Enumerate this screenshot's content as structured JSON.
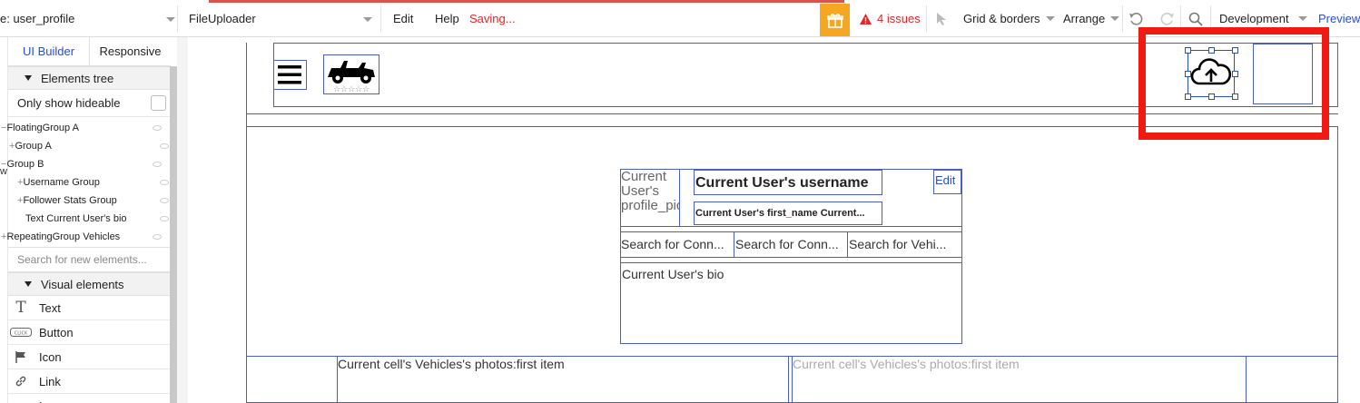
{
  "toolbar": {
    "page_name": "e: user_profile",
    "element_name": "FileUploader",
    "edit": "Edit",
    "help": "Help",
    "status": "Saving...",
    "issues": "4 issues",
    "grid": "Grid & borders",
    "arrange": "Arrange",
    "environment": "Development",
    "preview": "Preview",
    "colors": {
      "status_red": "#e0262b",
      "accent_blue": "#2a4ec4",
      "gift_orange": "#f5a623"
    }
  },
  "left_panel": {
    "tabs": [
      "UI Builder",
      "Responsive"
    ],
    "elements_tree_header": "Elements tree",
    "only_show_hideable": "Only show hideable",
    "tree_items": [
      "FloatingGroup A",
      "Group A",
      "Group B",
      "Username Group",
      "Follower Stats Group",
      "Text Current User's bio",
      "RepeatingGroup Vehicles"
    ],
    "search_placeholder": "Search for new elements...",
    "visual_elements_header": "Visual elements",
    "visual_items": [
      "Text",
      "Button",
      "Icon",
      "Link",
      "I"
    ],
    "edge_label": "w"
  },
  "canvas": {
    "profile_pic": "Current User's profile_pic",
    "username": "Current User's username",
    "edit_link": "Edit",
    "first_name": "Current User's first_name Current...",
    "search_connections_1": "Search for Conn...",
    "search_connections_2": "Search for Conn...",
    "search_vehicles": "Search for Vehi...",
    "bio": "Current User's bio",
    "cell_1": "Current cell's Vehicles's photos:first item",
    "cell_2": "Current cell's Vehicles's photos:first item"
  }
}
